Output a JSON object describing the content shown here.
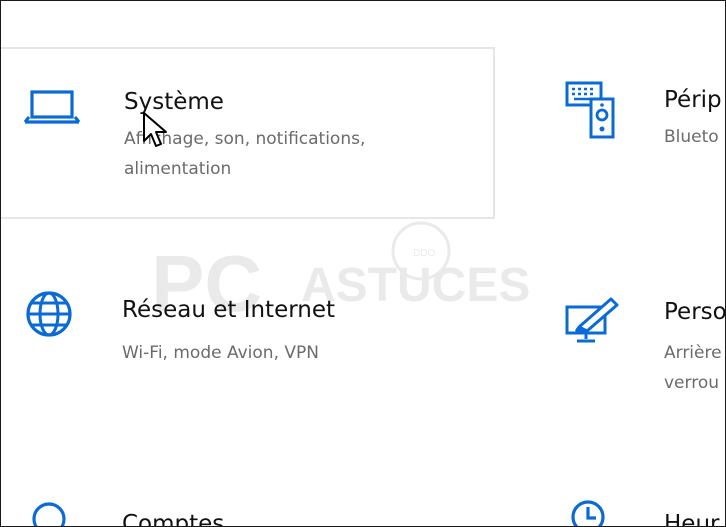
{
  "tiles": [
    {
      "title": "Système",
      "desc1": "Affichage, son, notifications,",
      "desc2": "alimentation",
      "icon": "laptop-icon"
    },
    {
      "title": "Périp",
      "desc1": "Blueto",
      "desc2": "",
      "icon": "devices-icon"
    },
    {
      "title": "Réseau et Internet",
      "desc1": "Wi-Fi, mode Avion, VPN",
      "desc2": "",
      "icon": "globe-icon"
    },
    {
      "title": "Perso",
      "desc1": "Arrière",
      "desc2": "verrou",
      "icon": "personalization-icon"
    },
    {
      "title": "Comptes",
      "desc1": "",
      "desc2": "",
      "icon": "person-icon"
    },
    {
      "title": "Heur",
      "desc1": "",
      "desc2": "",
      "icon": "clock-icon"
    }
  ],
  "watermark": {
    "text_left": "PC",
    "text_right": "ASTUCES",
    "tagline": "DDO"
  },
  "colors": {
    "accent": "#0a6ad6",
    "title": "#111111",
    "desc": "#6b6b6b"
  }
}
